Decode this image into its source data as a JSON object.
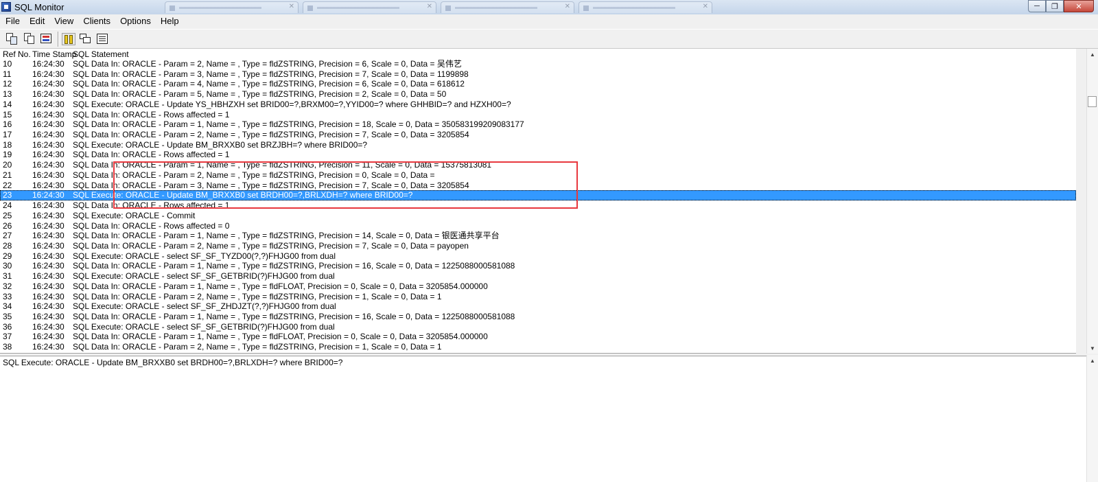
{
  "window": {
    "title": "SQL Monitor",
    "minimize_label": "─",
    "maximize_label": "❐",
    "close_label": "✕"
  },
  "menu": [
    {
      "label": "File"
    },
    {
      "label": "Edit"
    },
    {
      "label": "View"
    },
    {
      "label": "Clients"
    },
    {
      "label": "Options"
    },
    {
      "label": "Help"
    }
  ],
  "toolbar": {
    "icons": [
      "save-log-icon",
      "copy-icon",
      "print-icon",
      "pause-icon",
      "select-all-icon",
      "options-checklist-icon"
    ]
  },
  "list": {
    "headers": {
      "ref": "Ref No.",
      "time": "Time Stamp",
      "sql": "SQL Statement"
    },
    "selected_ref": "23",
    "rows": [
      {
        "ref": "10",
        "time": "16:24:30",
        "sql": "SQL Data In: ORACLE - Param = 2, Name = , Type = fldZSTRING, Precision = 6, Scale = 0, Data = 吴伟艺"
      },
      {
        "ref": "11",
        "time": "16:24:30",
        "sql": "SQL Data In: ORACLE - Param = 3, Name = , Type = fldZSTRING, Precision = 7, Scale = 0, Data = 1199898"
      },
      {
        "ref": "12",
        "time": "16:24:30",
        "sql": "SQL Data In: ORACLE - Param = 4, Name = , Type = fldZSTRING, Precision = 6, Scale = 0, Data = 618612"
      },
      {
        "ref": "13",
        "time": "16:24:30",
        "sql": "SQL Data In: ORACLE - Param = 5, Name = , Type = fldZSTRING, Precision = 2, Scale = 0, Data = 50"
      },
      {
        "ref": "14",
        "time": "16:24:30",
        "sql": "SQL Execute: ORACLE - Update YS_HBHZXH set BRID00=?,BRXM00=?,YYID00=? where GHHBID=? and HZXH00=?"
      },
      {
        "ref": "15",
        "time": "16:24:30",
        "sql": "SQL Data In: ORACLE - Rows affected = 1"
      },
      {
        "ref": "16",
        "time": "16:24:30",
        "sql": "SQL Data In: ORACLE - Param = 1, Name = , Type = fldZSTRING, Precision = 18, Scale = 0, Data = 350583199209083177"
      },
      {
        "ref": "17",
        "time": "16:24:30",
        "sql": "SQL Data In: ORACLE - Param = 2, Name = , Type = fldZSTRING, Precision = 7, Scale = 0, Data = 3205854"
      },
      {
        "ref": "18",
        "time": "16:24:30",
        "sql": "SQL Execute: ORACLE - Update BM_BRXXB0 set BRZJBH=? where BRID00=?"
      },
      {
        "ref": "19",
        "time": "16:24:30",
        "sql": "SQL Data In: ORACLE - Rows affected = 1"
      },
      {
        "ref": "20",
        "time": "16:24:30",
        "sql": "SQL Data In: ORACLE - Param = 1, Name = , Type = fldZSTRING, Precision = 11, Scale = 0, Data = 15375813081"
      },
      {
        "ref": "21",
        "time": "16:24:30",
        "sql": "SQL Data In: ORACLE - Param = 2, Name = , Type = fldZSTRING, Precision = 0, Scale = 0, Data ="
      },
      {
        "ref": "22",
        "time": "16:24:30",
        "sql": "SQL Data In: ORACLE - Param = 3, Name = , Type = fldZSTRING, Precision = 7, Scale = 0, Data = 3205854"
      },
      {
        "ref": "23",
        "time": "16:24:30",
        "sql": "SQL Execute: ORACLE - Update BM_BRXXB0 set BRDH00=?,BRLXDH=? where BRID00=?"
      },
      {
        "ref": "24",
        "time": "16:24:30",
        "sql": "SQL Data In: ORACLE - Rows affected = 1"
      },
      {
        "ref": "25",
        "time": "16:24:30",
        "sql": "SQL Execute: ORACLE - Commit"
      },
      {
        "ref": "26",
        "time": "16:24:30",
        "sql": "SQL Data In: ORACLE - Rows affected = 0"
      },
      {
        "ref": "27",
        "time": "16:24:30",
        "sql": "SQL Data In: ORACLE - Param = 1, Name = , Type = fldZSTRING, Precision = 14, Scale = 0, Data = 银医通共享平台"
      },
      {
        "ref": "28",
        "time": "16:24:30",
        "sql": "SQL Data In: ORACLE - Param = 2, Name = , Type = fldZSTRING, Precision = 7, Scale = 0, Data = payopen"
      },
      {
        "ref": "29",
        "time": "16:24:30",
        "sql": "SQL Execute: ORACLE -  select SF_SF_TYZD00(?,?)FHJG00 from dual"
      },
      {
        "ref": "30",
        "time": "16:24:30",
        "sql": "SQL Data In: ORACLE - Param = 1, Name = , Type = fldZSTRING, Precision = 16, Scale = 0, Data = 1225088000581088"
      },
      {
        "ref": "31",
        "time": "16:24:30",
        "sql": "SQL Execute: ORACLE - select SF_SF_GETBRID(?)FHJG00  from dual"
      },
      {
        "ref": "32",
        "time": "16:24:30",
        "sql": "SQL Data In: ORACLE - Param = 1, Name = , Type = fldFLOAT, Precision = 0, Scale = 0, Data = 3205854.000000"
      },
      {
        "ref": "33",
        "time": "16:24:30",
        "sql": "SQL Data In: ORACLE - Param = 2, Name = , Type = fldZSTRING, Precision = 1, Scale = 0, Data = 1"
      },
      {
        "ref": "34",
        "time": "16:24:30",
        "sql": "SQL Execute: ORACLE -  select SF_SF_ZHDJZT(?,?)FHJG00 from dual"
      },
      {
        "ref": "35",
        "time": "16:24:30",
        "sql": "SQL Data In: ORACLE - Param = 1, Name = , Type = fldZSTRING, Precision = 16, Scale = 0, Data = 1225088000581088"
      },
      {
        "ref": "36",
        "time": "16:24:30",
        "sql": "SQL Execute: ORACLE - select SF_SF_GETBRID(?)FHJG00  from dual"
      },
      {
        "ref": "37",
        "time": "16:24:30",
        "sql": "SQL Data In: ORACLE - Param = 1, Name = , Type = fldFLOAT, Precision = 0, Scale = 0, Data = 3205854.000000"
      },
      {
        "ref": "38",
        "time": "16:24:30",
        "sql": "SQL Data In: ORACLE - Param = 2, Name = , Type = fldZSTRING, Precision = 1, Scale = 0, Data = 1"
      }
    ]
  },
  "detail": {
    "text": "SQL Execute: ORACLE - Update BM_BRXXB0 set BRDH00=?,BRLXDH=? where BRID00=?"
  },
  "colors": {
    "selection": "#3399ff",
    "annotation": "#e8373d"
  }
}
